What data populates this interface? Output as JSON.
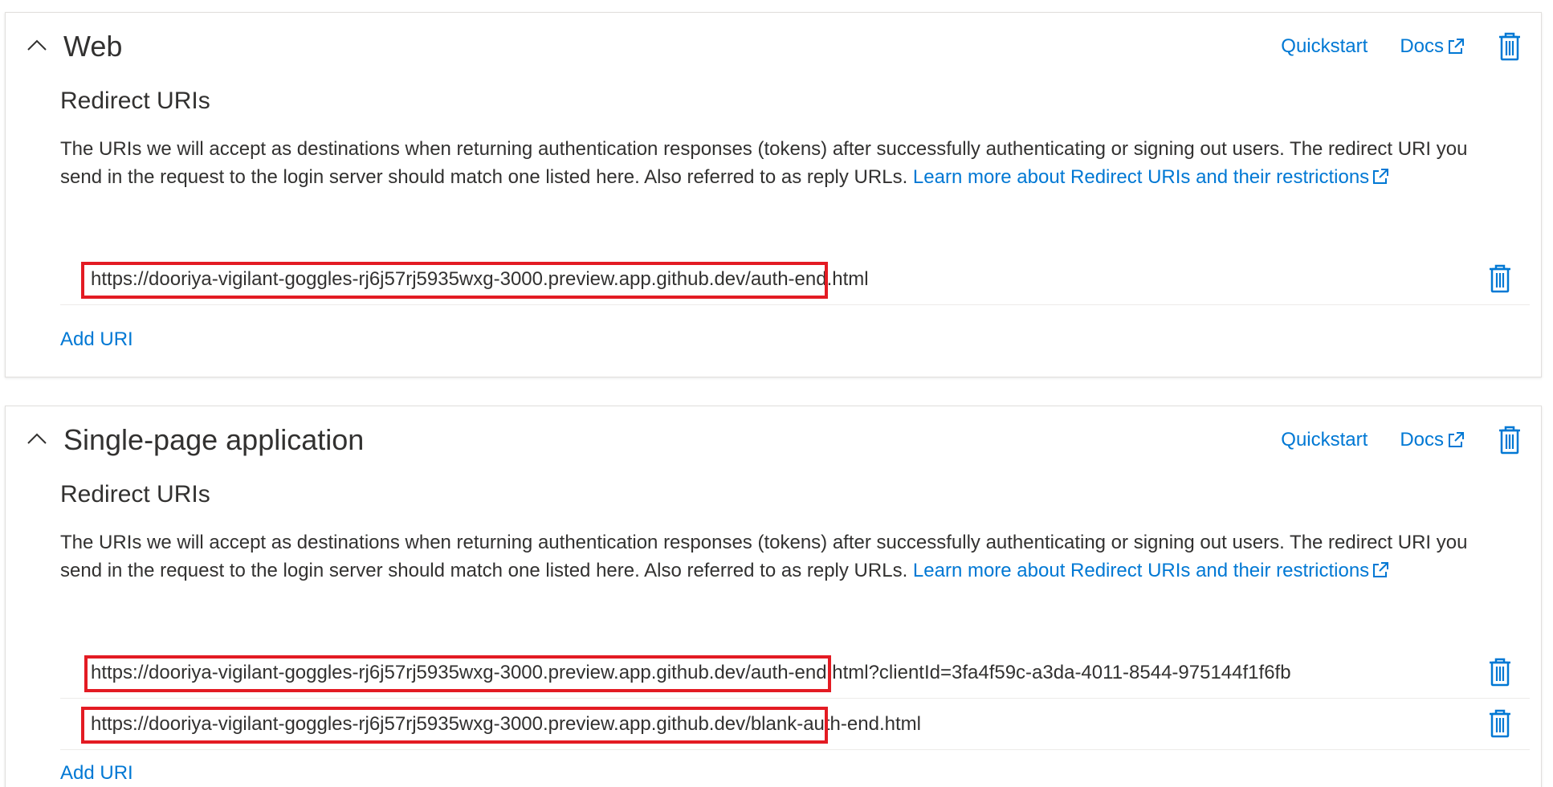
{
  "colors": {
    "link": "#0078d4",
    "text": "#323130",
    "highlight": "#e31b23",
    "border": "#e1dfdd"
  },
  "web": {
    "title": "Web",
    "quickstart_label": "Quickstart",
    "docs_label": "Docs",
    "redirect_heading": "Redirect URIs",
    "description_text": "The URIs we will accept as destinations when returning authentication responses (tokens) after successfully authenticating or signing out users. The redirect URI you send in the request to the login server should match one listed here. Also referred to as reply URLs. ",
    "learn_more_label": "Learn more about Redirect URIs and their restrictions",
    "uris": [
      "https://dooriya-vigilant-goggles-rj6j57rj5935wxg-3000.preview.app.github.dev/auth-end.html"
    ],
    "add_uri_label": "Add URI"
  },
  "spa": {
    "title": "Single-page application",
    "quickstart_label": "Quickstart",
    "docs_label": "Docs",
    "redirect_heading": "Redirect URIs",
    "description_text": "The URIs we will accept as destinations when returning authentication responses (tokens) after successfully authenticating or signing out users. The redirect URI you send in the request to the login server should match one listed here. Also referred to as reply URLs. ",
    "learn_more_label": "Learn more about Redirect URIs and their restrictions",
    "uris": [
      "https://dooriya-vigilant-goggles-rj6j57rj5935wxg-3000.preview.app.github.dev/auth-end.html?clientId=3fa4f59c-a3da-4011-8544-975144f1f6fb",
      "https://dooriya-vigilant-goggles-rj6j57rj5935wxg-3000.preview.app.github.dev/blank-auth-end.html"
    ],
    "add_uri_label": "Add URI"
  },
  "icons": {
    "collapse": "chevron-up-icon",
    "external": "external-link-icon",
    "delete": "trash-icon"
  }
}
